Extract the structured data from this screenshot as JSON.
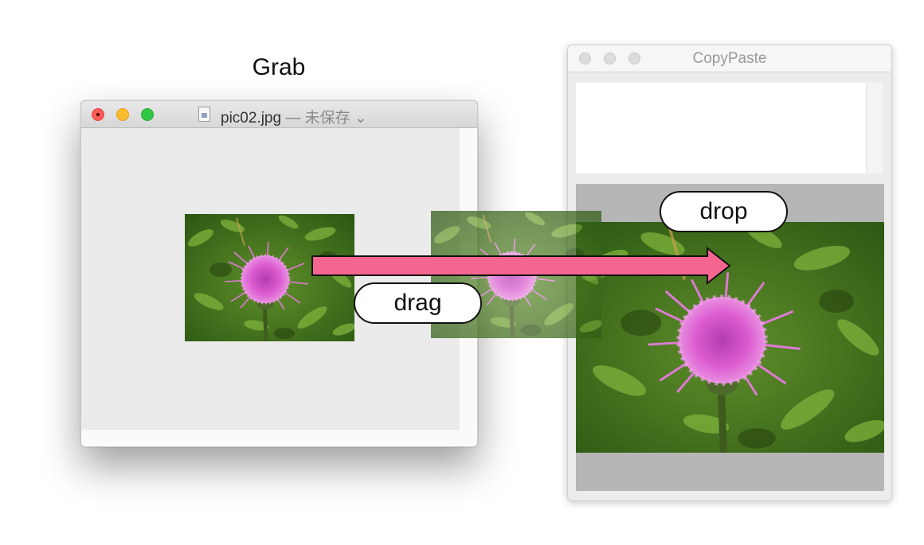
{
  "caption": "Grab",
  "grab_window": {
    "filename": "pic02.jpg",
    "separator": "—",
    "status": "未保存",
    "status_chevron": "⌄",
    "controls": [
      "close-button",
      "minimize-button",
      "zoom-button"
    ],
    "image": "thistle flower photo"
  },
  "copypaste_window": {
    "title": "CopyPaste",
    "image": "thistle flower photo"
  },
  "annotations": {
    "drag": "drag",
    "drop": "drop",
    "arrow_color": "#f4658f"
  },
  "icons": [
    "document-icon",
    "chevron-down-icon",
    "arrow-right-icon"
  ]
}
